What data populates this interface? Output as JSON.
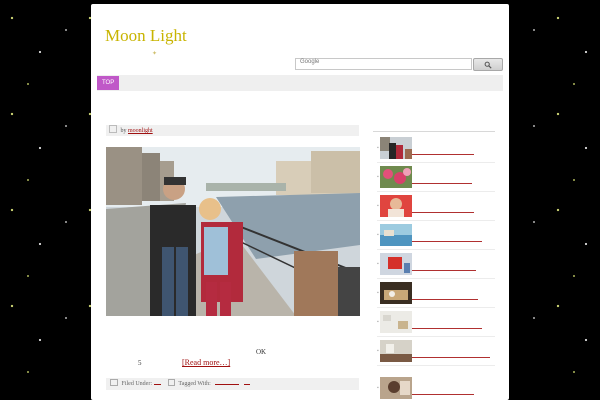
{
  "site": {
    "title": "Moon Light",
    "tagline_mark": "✦"
  },
  "search": {
    "placeholder": "Google",
    "button_icon": "search-icon"
  },
  "nav": {
    "items": [
      {
        "label": "TOP"
      }
    ]
  },
  "post": {
    "meta_prefix": "by",
    "author": "moonlight",
    "number": "5",
    "read_more": "[Read more…]",
    "extra_text": "OK",
    "filed_under": "Filed Under:",
    "tagged_with": "Tagged With:"
  },
  "sidebar": {
    "items": [
      {
        "thumb": "couple-street-photo"
      },
      {
        "thumb": "pink-flowers-photo"
      },
      {
        "thumb": "woman-red-photo"
      },
      {
        "thumb": "blue-sea-photo"
      },
      {
        "thumb": "tablet-desk-photo"
      },
      {
        "thumb": "cafe-table-photo"
      },
      {
        "thumb": "white-room-photo"
      },
      {
        "thumb": "interior-photo"
      },
      {
        "thumb": "portrait-photo"
      }
    ]
  },
  "colors": {
    "title": "#c8b400",
    "nav_accent": "#c058c8",
    "link": "#a01010",
    "background": "#000000"
  }
}
